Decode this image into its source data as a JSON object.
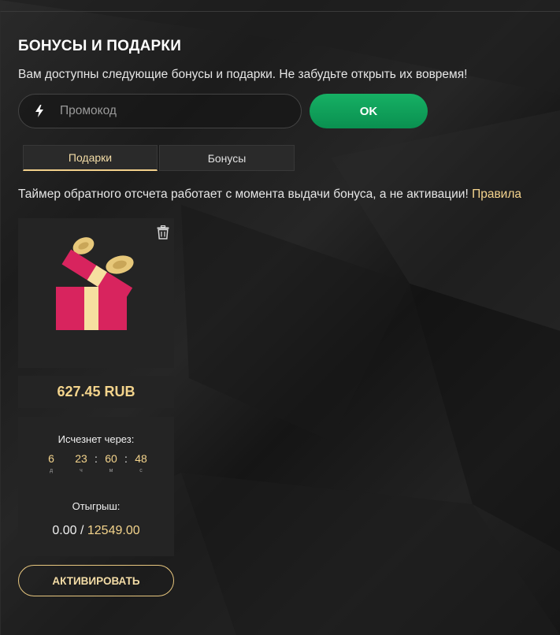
{
  "header": {
    "title": "БОНУСЫ И ПОДАРКИ",
    "subtitle": "Вам доступны следующие бонусы и подарки. Не забудьте открыть их вовремя!"
  },
  "promo": {
    "placeholder": "Промокод",
    "icon": "lightning-icon",
    "ok_label": "OK"
  },
  "tabs": [
    {
      "label": "Подарки",
      "active": true
    },
    {
      "label": "Бонусы",
      "active": false
    }
  ],
  "notice": {
    "text": "Таймер обратного отсчета работает с момента выдачи бонуса, а не активации!",
    "link": "Правила"
  },
  "gift_card": {
    "image_icon": "gift-box-icon",
    "delete_icon": "trash-icon",
    "amount": "627.45 RUB",
    "expires_label": "Исчезнет через:",
    "timer": {
      "days": "6",
      "days_cap": "д",
      "hours": "23",
      "hours_cap": "ч",
      "minutes": "60",
      "minutes_cap": "м",
      "seconds": "48",
      "seconds_cap": "с"
    },
    "wager_label": "Отыгрыш:",
    "wager_current": "0.00",
    "wager_separator": "/",
    "wager_target": "12549.00",
    "activate_label": "АКТИВИРОВАТЬ"
  },
  "colors": {
    "accent_gold": "#f4d48c",
    "ok_green": "#0fa05a",
    "gift_red": "#d8245e",
    "gift_ribbon": "#f6e0a0"
  }
}
